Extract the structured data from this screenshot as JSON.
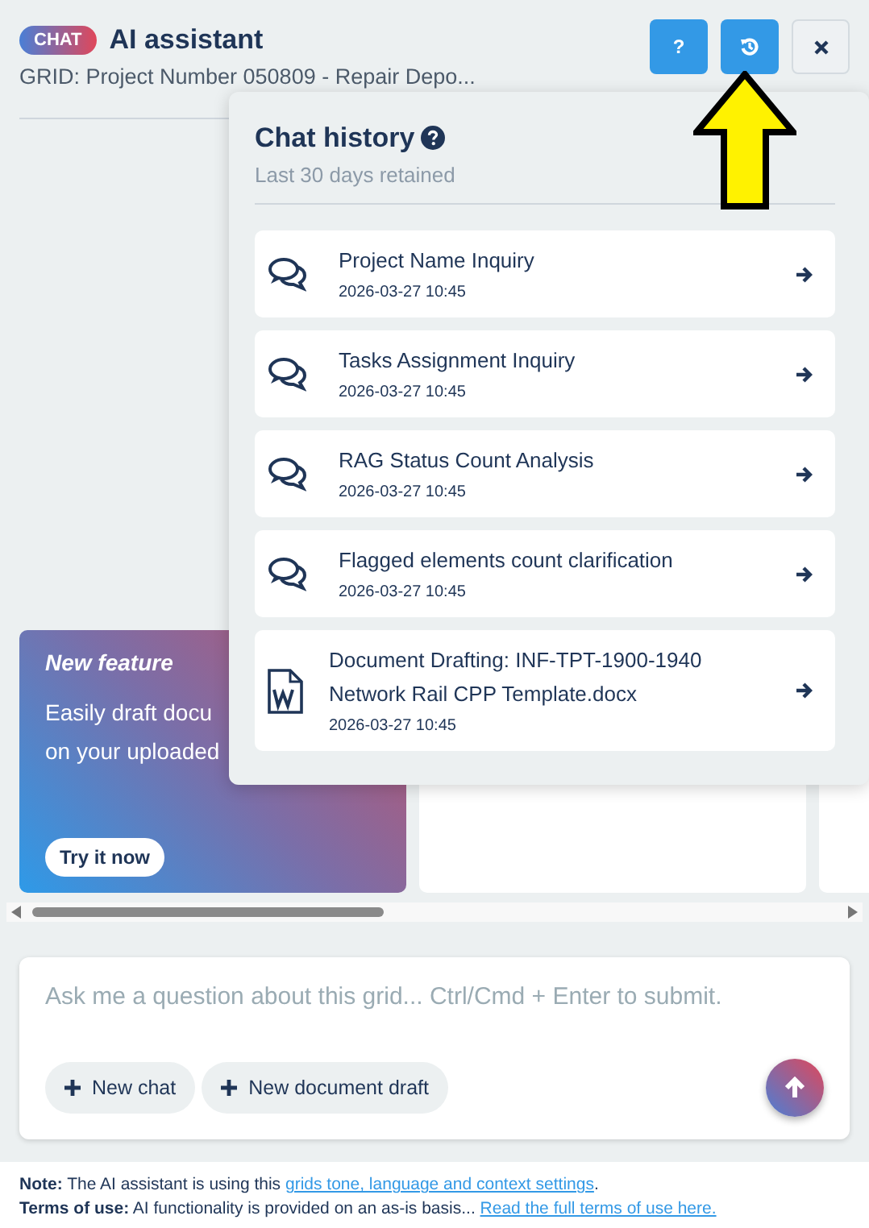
{
  "header": {
    "badge": "CHAT",
    "title": "AI assistant",
    "subtitle": "GRID: Project Number 050809 - Repair Depo...",
    "buttons": [
      {
        "kind": "help",
        "label": "?"
      },
      {
        "kind": "history"
      },
      {
        "kind": "close"
      }
    ]
  },
  "feature": {
    "title": "New feature",
    "lines": [
      "Easily draft docu",
      "on your uploaded"
    ],
    "button": "Try it now"
  },
  "history": {
    "title": "Chat history",
    "subtitle": "Last 30 days retained",
    "items": [
      {
        "kind": "chat",
        "title": "Project Name Inquiry",
        "time": "2026-03-27 10:45"
      },
      {
        "kind": "chat",
        "title": "Tasks Assignment Inquiry",
        "time": "2026-03-27 10:45"
      },
      {
        "kind": "chat",
        "title": "RAG Status Count Analysis",
        "time": "2026-03-27 10:45"
      },
      {
        "kind": "chat",
        "title": "Flagged elements count clarification",
        "time": "2026-03-27 10:45"
      },
      {
        "kind": "document",
        "title": "Document Drafting: INF-TPT-1900-1940 Network Rail CPP Template.docx",
        "time": "2026-03-27 10:45"
      }
    ]
  },
  "composer": {
    "placeholder": "Ask me a question about this grid... Ctrl/Cmd + Enter to submit.",
    "buttons": [
      "New chat",
      "New document draft"
    ]
  },
  "footer": [
    {
      "text": "**Note:** The AI assistant is using this",
      "link": "grids tone, language and context settings",
      "after": "."
    },
    {
      "text": "**Terms of use:** AI functionality is provided on an as-is basis...",
      "link": "Read the full terms of use here."
    }
  ]
}
